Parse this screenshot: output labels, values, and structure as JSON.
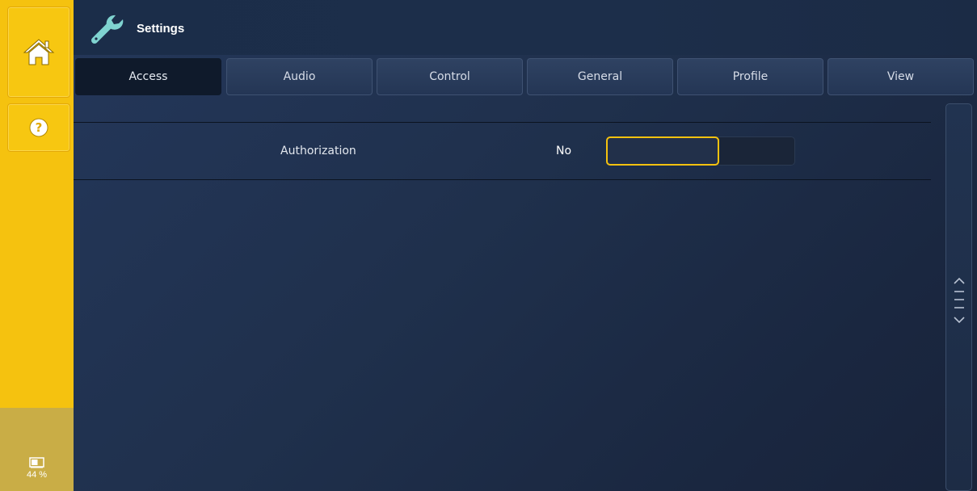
{
  "sidebar": {
    "home_icon": "home-icon",
    "help_icon": "question-mark-icon",
    "battery": {
      "icon": "battery-icon",
      "level_text": "44 %",
      "level": 0.44
    }
  },
  "header": {
    "icon": "wrench-icon",
    "title": "Settings"
  },
  "tabs": [
    {
      "label": "Access",
      "active": true
    },
    {
      "label": "Audio",
      "active": false
    },
    {
      "label": "Control",
      "active": false
    },
    {
      "label": "General",
      "active": false
    },
    {
      "label": "Profile",
      "active": false
    },
    {
      "label": "View",
      "active": false
    }
  ],
  "settings": [
    {
      "label": "Authorization",
      "value": "No",
      "control": "toggle"
    }
  ],
  "scrollbar": {
    "icons": [
      "chevron-up-icon",
      "grip-icon",
      "chevron-down-icon"
    ]
  },
  "colors": {
    "accent": "#f5c20f",
    "panel": "#1d2b40",
    "active_tab": "#0f1a2b"
  }
}
